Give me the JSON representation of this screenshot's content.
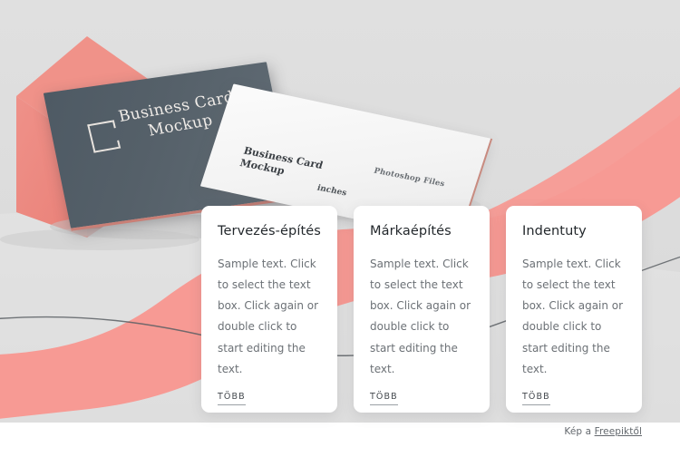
{
  "hero": {
    "background_color": "#dcdcdc",
    "coral_color": "#f79a94",
    "box_color": "#e98a80",
    "dark_card": {
      "color": "#556069",
      "logo_icon": "square-bracket-logo-icon",
      "title_line_1": "Business Card",
      "title_line_2": "Mockup"
    },
    "white_card": {
      "color": "#f4f4f4",
      "title": "Business Card Mockup",
      "subtitle": "inches",
      "note": "Photoshop Files"
    }
  },
  "cards": [
    {
      "title": "Tervezés-építés",
      "body": "Sample text. Click to select the text box. Click again or double click to start editing the text.",
      "link_label": "Több"
    },
    {
      "title": "Márkaépítés",
      "body": "Sample text. Click to select the text box. Click again or double click to start editing the text.",
      "link_label": "Több"
    },
    {
      "title": "Indentuty",
      "body": "Sample text. Click to select the text box. Click again or double click to start editing the text.",
      "link_label": "Több"
    }
  ],
  "attribution": {
    "prefix": "Kép a ",
    "link_label": "Freepiktől"
  }
}
